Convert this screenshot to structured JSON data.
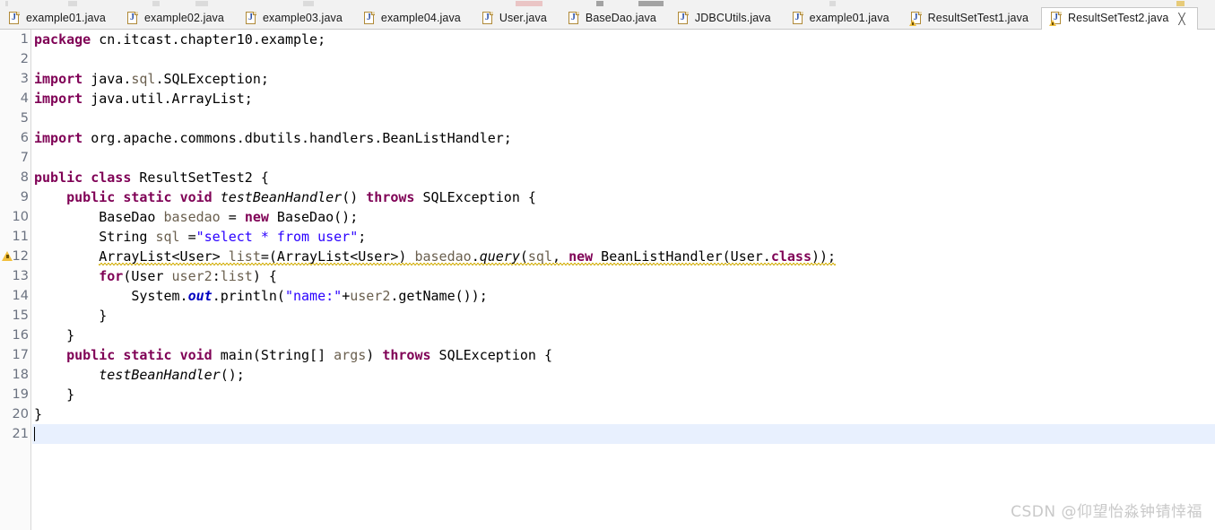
{
  "window": {
    "app": "Eclipse IDE",
    "active_file": "ResultSetTest2.java"
  },
  "tabs": [
    {
      "label": "example01.java",
      "icon": "java-file-icon",
      "active": false,
      "warning": false
    },
    {
      "label": "example02.java",
      "icon": "java-file-icon",
      "active": false,
      "warning": false
    },
    {
      "label": "example03.java",
      "icon": "java-file-icon",
      "active": false,
      "warning": false
    },
    {
      "label": "example04.java",
      "icon": "java-file-icon",
      "active": false,
      "warning": false
    },
    {
      "label": "User.java",
      "icon": "java-file-icon",
      "active": false,
      "warning": false
    },
    {
      "label": "BaseDao.java",
      "icon": "java-file-icon",
      "active": false,
      "warning": false
    },
    {
      "label": "JDBCUtils.java",
      "icon": "java-file-icon",
      "active": false,
      "warning": false
    },
    {
      "label": "example01.java",
      "icon": "java-file-icon",
      "active": false,
      "warning": false
    },
    {
      "label": "ResultSetTest1.java",
      "icon": "java-file-warning-icon",
      "active": false,
      "warning": true
    },
    {
      "label": "ResultSetTest2.java",
      "icon": "java-file-warning-icon",
      "active": true,
      "warning": true,
      "close_glyph": "╳"
    }
  ],
  "editor": {
    "language": "Java",
    "cursor_line": 21,
    "colors": {
      "keyword": "#7f0055",
      "string": "#2a00ff",
      "local_variable": "#6a5f4e",
      "static_field": "#0000c0",
      "current_line": "#e8f0fe",
      "warning_squiggle": "#d8b826",
      "change_bar": "#4a7ebb",
      "gutter_bg": "#fafafa",
      "editor_bg": "#ffffff"
    },
    "lines": [
      {
        "n": 1,
        "fold": false,
        "warn": false,
        "changed": false,
        "text": "package cn.itcast.chapter10.example;"
      },
      {
        "n": 2,
        "fold": false,
        "warn": false,
        "changed": false,
        "text": ""
      },
      {
        "n": 3,
        "fold": true,
        "warn": false,
        "changed": false,
        "text": "import java.sql.SQLException;"
      },
      {
        "n": 4,
        "fold": false,
        "warn": false,
        "changed": false,
        "text": "import java.util.ArrayList;"
      },
      {
        "n": 5,
        "fold": false,
        "warn": false,
        "changed": false,
        "text": ""
      },
      {
        "n": 6,
        "fold": false,
        "warn": false,
        "changed": false,
        "text": "import org.apache.commons.dbutils.handlers.BeanListHandler;"
      },
      {
        "n": 7,
        "fold": false,
        "warn": false,
        "changed": false,
        "text": ""
      },
      {
        "n": 8,
        "fold": false,
        "warn": false,
        "changed": false,
        "text": "public class ResultSetTest2 {"
      },
      {
        "n": 9,
        "fold": true,
        "warn": false,
        "changed": false,
        "text": "    public static void testBeanHandler() throws SQLException {"
      },
      {
        "n": 10,
        "fold": false,
        "warn": false,
        "changed": false,
        "text": "        BaseDao basedao = new BaseDao();"
      },
      {
        "n": 11,
        "fold": false,
        "warn": false,
        "changed": false,
        "text": "        String sql =\"select * from user\";"
      },
      {
        "n": 12,
        "fold": false,
        "warn": true,
        "changed": false,
        "text": "        ArrayList<User> list=(ArrayList<User>) basedao.query(sql, new BeanListHandler(User.class));"
      },
      {
        "n": 13,
        "fold": false,
        "warn": false,
        "changed": false,
        "text": "        for(User user2:list) {"
      },
      {
        "n": 14,
        "fold": false,
        "warn": false,
        "changed": false,
        "text": "            System.out.println(\"name:\"+user2.getName());"
      },
      {
        "n": 15,
        "fold": false,
        "warn": false,
        "changed": false,
        "text": "        }"
      },
      {
        "n": 16,
        "fold": false,
        "warn": false,
        "changed": false,
        "text": "    }"
      },
      {
        "n": 17,
        "fold": true,
        "warn": false,
        "changed": true,
        "text": "    public static void main(String[] args) throws SQLException {"
      },
      {
        "n": 18,
        "fold": false,
        "warn": false,
        "changed": true,
        "text": "        testBeanHandler();"
      },
      {
        "n": 19,
        "fold": false,
        "warn": false,
        "changed": true,
        "text": "    }"
      },
      {
        "n": 20,
        "fold": false,
        "warn": false,
        "changed": false,
        "text": "}"
      },
      {
        "n": 21,
        "fold": false,
        "warn": false,
        "changed": false,
        "text": ""
      }
    ]
  },
  "watermark": {
    "text": "CSDN @仰望怡淼钟锖悻福"
  }
}
